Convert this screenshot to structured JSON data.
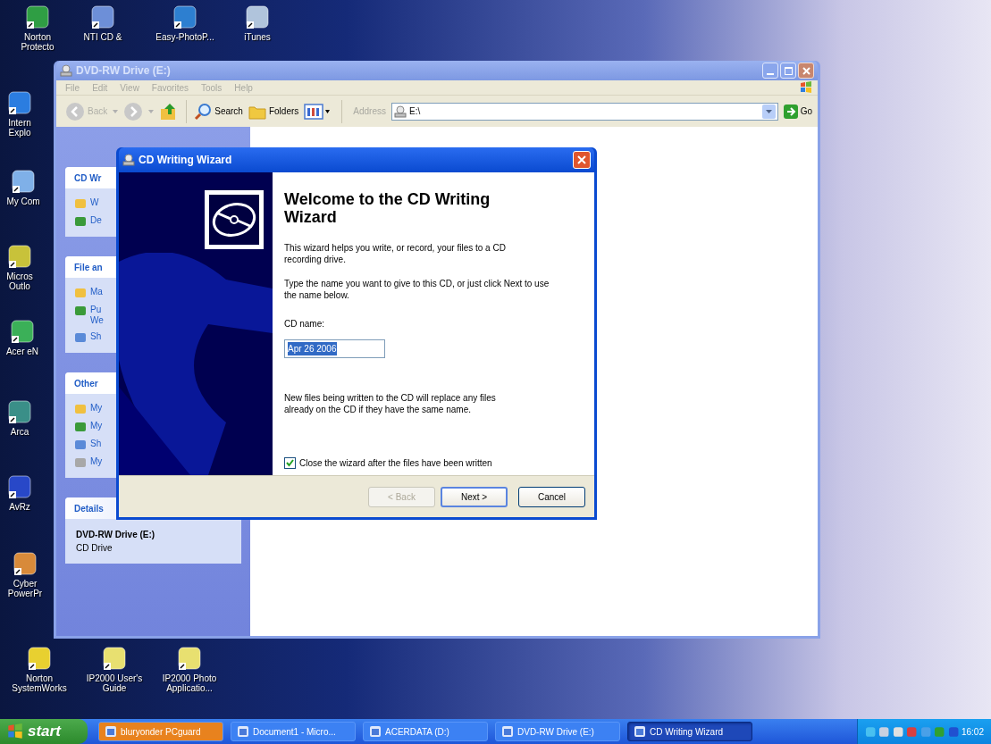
{
  "desktop_icons": [
    {
      "label": "Norton\nProtecto"
    },
    {
      "label": "NTI CD &"
    },
    {
      "label": "Easy-PhotoP..."
    },
    {
      "label": "iTunes"
    },
    {
      "label": "Intern\nExplo"
    },
    {
      "label": "My Com"
    },
    {
      "label": "Micros\nOutlo"
    },
    {
      "label": "Acer eN"
    },
    {
      "label": "Arca"
    },
    {
      "label": "AvRz"
    },
    {
      "label": "Cyber\nPowerPr"
    },
    {
      "label": "Norton\nSystemWorks"
    },
    {
      "label": "IP2000 User's\nGuide"
    },
    {
      "label": "IP2000 Photo\nApplicatio..."
    }
  ],
  "explorer": {
    "title": "DVD-RW Drive (E:)",
    "active": false,
    "menu": [
      "File",
      "Edit",
      "View",
      "Favorites",
      "Tools",
      "Help"
    ],
    "toolbar": {
      "back": {
        "label": "Back",
        "disabled": true
      },
      "search": "Search",
      "folders": "Folders",
      "address_label": "Address",
      "address": "E:\\",
      "go": "Go"
    },
    "task_pane": [
      {
        "title": "CD Wr",
        "items": [
          "W",
          "De"
        ]
      },
      {
        "title": "File an",
        "items": [
          "Ma",
          "Pu\nWe",
          "Sh"
        ]
      },
      {
        "title": "Other",
        "items": [
          "My",
          "My",
          "Sh",
          "My"
        ]
      }
    ],
    "details": {
      "title": "Details",
      "name": "DVD-RW Drive (E:)",
      "type": "CD Drive"
    }
  },
  "wizard": {
    "title": "CD Writing Wizard",
    "active": true,
    "heading": "Welcome to the CD Writing Wizard",
    "intro": "This wizard helps you write, or record, your files to a CD recording drive.",
    "instruction": "Type the name you want to give to this CD, or just click Next to use the name below.",
    "cd_name_label": "CD name:",
    "cd_name": {
      "value": "Apr 26 2006",
      "selected": true
    },
    "warning": "New files being written to the CD will replace any files already on the CD if they have the same name.",
    "close_option": {
      "label": "Close the wizard after the files have been written",
      "checked": true
    },
    "buttons": [
      {
        "label": "< Back",
        "disabled": true,
        "default": false
      },
      {
        "label": "Next >",
        "disabled": false,
        "default": true
      },
      {
        "label": "Cancel",
        "disabled": false,
        "default": false
      }
    ]
  },
  "taskbar": {
    "start": "start",
    "tasks": [
      {
        "label": "bluryonder PCguard",
        "flashing": true,
        "selected": false
      },
      {
        "label": "Document1 - Micro...",
        "flashing": false,
        "selected": false
      },
      {
        "label": "ACERDATA (D:)",
        "flashing": false,
        "selected": false
      },
      {
        "label": "DVD-RW Drive (E:)",
        "flashing": false,
        "selected": false
      },
      {
        "label": "CD Writing Wizard",
        "flashing": false,
        "selected": true
      }
    ],
    "clock": "16:02"
  }
}
